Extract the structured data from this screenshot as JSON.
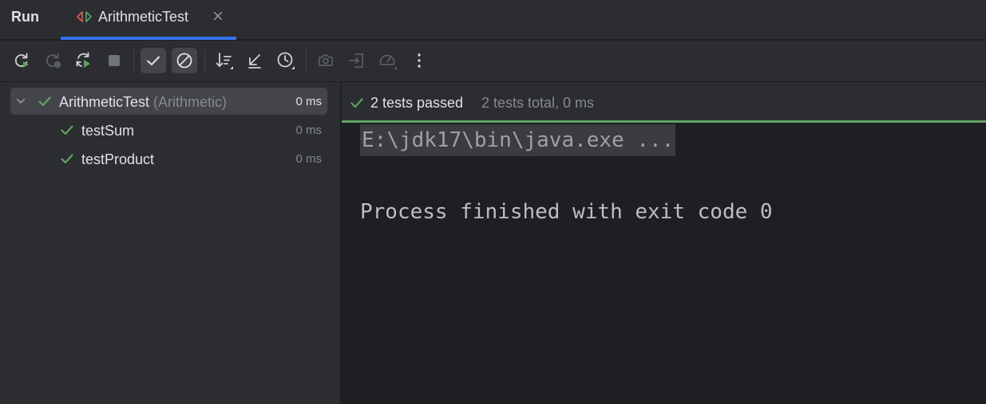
{
  "header": {
    "tool_window_title": "Run",
    "tab": {
      "label": "ArithmeticTest",
      "icon": "junit-test-icon",
      "close_icon": "close-icon"
    }
  },
  "toolbar": {
    "buttons": [
      {
        "name": "rerun-icon",
        "enabled": true
      },
      {
        "name": "rerun-failed-icon",
        "enabled": false
      },
      {
        "name": "toggle-auto-test-icon",
        "enabled": true
      },
      {
        "name": "stop-icon",
        "enabled": false
      },
      {
        "name": "show-passed-icon",
        "active": true
      },
      {
        "name": "show-ignored-icon",
        "active": true
      },
      {
        "name": "sort-icon",
        "enabled": true
      },
      {
        "name": "collapse-all-icon",
        "enabled": true
      },
      {
        "name": "test-history-icon",
        "enabled": true
      },
      {
        "name": "screenshot-icon",
        "enabled": false
      },
      {
        "name": "import-tests-icon",
        "enabled": false
      },
      {
        "name": "profiler-icon",
        "enabled": false
      },
      {
        "name": "more-options-icon",
        "enabled": true
      }
    ]
  },
  "tree": {
    "root": {
      "name": "ArithmeticTest",
      "qualifier": "(Arithmetic)",
      "time": "0 ms",
      "status": "passed"
    },
    "children": [
      {
        "name": "testSum",
        "time": "0 ms",
        "status": "passed"
      },
      {
        "name": "testProduct",
        "time": "0 ms",
        "status": "passed"
      }
    ]
  },
  "status": {
    "passed_text": "2 tests passed",
    "total_text": "2 tests total, 0 ms",
    "progress_percent": 100,
    "progress_color": "#5fa360"
  },
  "console": {
    "command_line": "E:\\jdk17\\bin\\java.exe ...",
    "finish_line": "Process finished with exit code 0"
  },
  "colors": {
    "accent": "#3574f0",
    "success": "#5fa360",
    "panel": "#2b2d30",
    "editor": "#1e1f22"
  }
}
